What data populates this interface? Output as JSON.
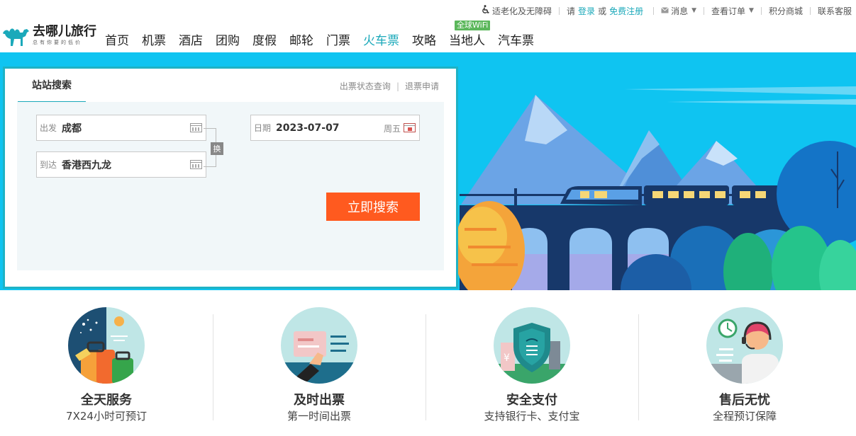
{
  "util_bar": {
    "accessibility": "适老化及无障碍",
    "please": "请",
    "login": "登录",
    "or": "或",
    "register": "免费注册",
    "messages": "消息",
    "orders": "查看订单",
    "points_mall": "积分商城",
    "customer_service": "联系客服"
  },
  "logo": {
    "name": "去哪儿旅行",
    "slogan": "总有你要的低价"
  },
  "nav": {
    "items": [
      "首页",
      "机票",
      "酒店",
      "团购",
      "度假",
      "邮轮",
      "门票",
      "火车票",
      "攻略",
      "当地人",
      "汽车票"
    ],
    "active": "火车票",
    "badge": "全球WiFi"
  },
  "search": {
    "tab_active": "站站搜索",
    "link_status": "出票状态查询",
    "link_refund": "退票申请",
    "from_label": "出发",
    "from_value": "成都",
    "to_label": "到达",
    "to_value": "香港西九龙",
    "date_label": "日期",
    "date_value": "2023-07-07",
    "weekday": "周五",
    "swap_label": "换",
    "button": "立即搜索"
  },
  "features": [
    {
      "title": "全天服务",
      "subtitle": "7X24小时可预订"
    },
    {
      "title": "及时出票",
      "subtitle": "第一时间出票"
    },
    {
      "title": "安全支付",
      "subtitle": "支持银行卡、支付宝"
    },
    {
      "title": "售后无忧",
      "subtitle": "全程预订保障"
    }
  ],
  "colors": {
    "accent": "#1ba9ba",
    "search_button": "#ff5a1f",
    "banner_sky": "#0fc4f1",
    "badge": "#5bb75b"
  }
}
